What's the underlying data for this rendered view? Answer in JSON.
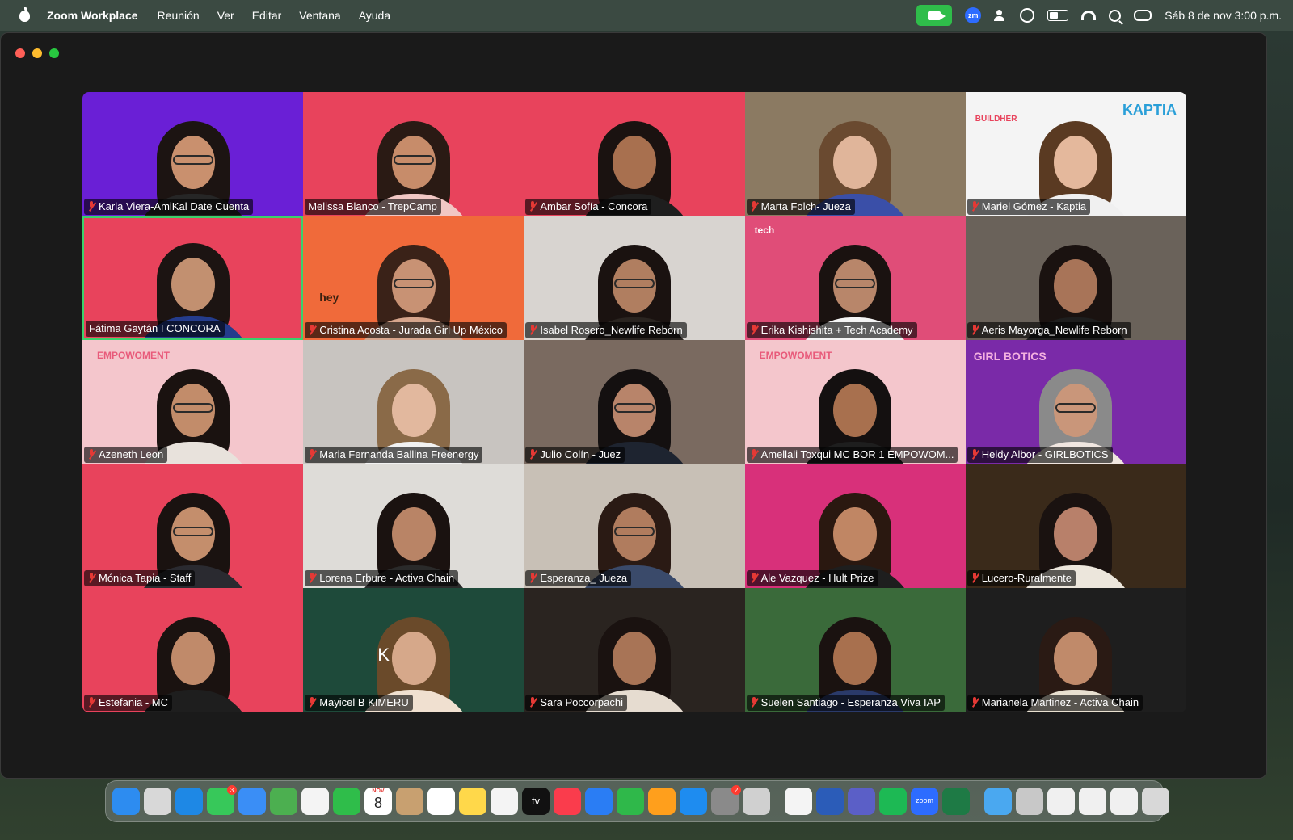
{
  "menubar": {
    "app_name": "Zoom Workplace",
    "menus": [
      "Reunión",
      "Ver",
      "Editar",
      "Ventana",
      "Ayuda"
    ],
    "zoom_badge": "zm",
    "datetime": "Sáb 8 de nov  3:00 p.m."
  },
  "participants": [
    {
      "name": "Karla Viera-AmiKal Date Cuenta",
      "muted": true,
      "bg": "#6a1fd6",
      "hair": "#1c1412",
      "skin": "#c9906e",
      "shirt": "#262626",
      "glasses": true
    },
    {
      "name": "Melissa Blanco - TrepCamp",
      "muted": false,
      "bg": "#e8435c",
      "hair": "#2a1a14",
      "skin": "#c78c6a",
      "shirt": "#f1c7c4",
      "glasses": true
    },
    {
      "name": "Ambar Sofía - Concora",
      "muted": true,
      "bg": "#e8435c",
      "hair": "#1a1210",
      "skin": "#a8704f",
      "shirt": "#1e1e1e",
      "glasses": false
    },
    {
      "name": "Marta Folch- Jueza",
      "muted": true,
      "bg": "#8b7a62",
      "hair": "#6a4a30",
      "skin": "#e0b59a",
      "shirt": "#3a4fa8",
      "glasses": false
    },
    {
      "name": "Mariel Gómez - Kaptia",
      "muted": true,
      "bg": "#f4f4f4",
      "hair": "#5a3a22",
      "skin": "#e4b89c",
      "shirt": "#f0f0f0",
      "glasses": false
    },
    {
      "name": "Fátima Gaytán I CONCORA",
      "muted": false,
      "bg": "#e8435c",
      "hair": "#1c1412",
      "skin": "#c29070",
      "shirt": "#243c8c",
      "glasses": false,
      "active": true
    },
    {
      "name": "Cristina Acosta - Jurada Girl Up México",
      "muted": true,
      "bg": "#f06a3a",
      "hair": "#3a2218",
      "skin": "#c89274",
      "shirt": "#d6a58c",
      "glasses": true
    },
    {
      "name": "Isabel Rosero_Newlife Reborn",
      "muted": true,
      "bg": "#d8d4d0",
      "hair": "#1a1210",
      "skin": "#b07e60",
      "shirt": "#2a2420",
      "glasses": true
    },
    {
      "name": "Erika Kishishita + Tech Academy",
      "muted": true,
      "bg": "#e04d78",
      "hair": "#1a1210",
      "skin": "#b8866a",
      "shirt": "#f4f4f4",
      "glasses": true
    },
    {
      "name": "Aeris Mayorga_Newlife Reborn",
      "muted": true,
      "bg": "#6a625a",
      "hair": "#1a1210",
      "skin": "#a87458",
      "shirt": "#1e1e1e",
      "glasses": false
    },
    {
      "name": "Azeneth Leon",
      "muted": true,
      "bg": "#f4c6cc",
      "hair": "#1a1210",
      "skin": "#c28c6a",
      "shirt": "#e8e2dc",
      "glasses": true
    },
    {
      "name": "Maria Fernanda Ballina Freenergy",
      "muted": true,
      "bg": "#c8c4c0",
      "hair": "#8a6a48",
      "skin": "#e2b89e",
      "shirt": "#f2f2f2",
      "glasses": false
    },
    {
      "name": "Julio Colín - Juez",
      "muted": true,
      "bg": "#7a6a60",
      "hair": "#141010",
      "skin": "#b8846a",
      "shirt": "#1e2430",
      "glasses": true
    },
    {
      "name": "Amellali Toxqui MC BOR 1  EMPOWOM...",
      "muted": true,
      "bg": "#f4c6cc",
      "hair": "#141010",
      "skin": "#a8704e",
      "shirt": "#1e1e1e",
      "glasses": false
    },
    {
      "name": "Heidy Albor - GIRLBOTICS",
      "muted": true,
      "bg": "#7a2aa8",
      "hair": "#8a8a8a",
      "skin": "#c9967a",
      "shirt": "#f0e6e0",
      "glasses": true
    },
    {
      "name": "Mónica Tapia - Staff",
      "muted": true,
      "bg": "#e8435c",
      "hair": "#1a1210",
      "skin": "#c48e6c",
      "shirt": "#2a2a30",
      "glasses": true
    },
    {
      "name": "Lorena Erbure - Activa Chain",
      "muted": true,
      "bg": "#dedcd8",
      "hair": "#1a1210",
      "skin": "#b98466",
      "shirt": "#2a2a2a",
      "glasses": false
    },
    {
      "name": "Esperanza_ Jueza",
      "muted": true,
      "bg": "#c8c0b6",
      "hair": "#2a1a14",
      "skin": "#b07c5e",
      "shirt": "#3a4a6a",
      "glasses": true
    },
    {
      "name": "Ale Vazquez - Hult Prize",
      "muted": true,
      "bg": "#d8307a",
      "hair": "#2a1810",
      "skin": "#c08664",
      "shirt": "#1e1e1e",
      "glasses": false
    },
    {
      "name": "Lucero-Ruralmente",
      "muted": true,
      "bg": "#3a2a1a",
      "hair": "#1a1210",
      "skin": "#b8806a",
      "shirt": "#ece6dc",
      "glasses": false
    },
    {
      "name": "Estefania - MC",
      "muted": true,
      "bg": "#e8435c",
      "hair": "#1a1210",
      "skin": "#c08a6a",
      "shirt": "#1e1e1e",
      "glasses": false
    },
    {
      "name": "Mayicel B KIMERU",
      "muted": true,
      "bg": "#1e4a3a",
      "hair": "#6a4a2a",
      "skin": "#d6a88a",
      "shirt": "#f0e0d0",
      "glasses": false
    },
    {
      "name": "Sara Poccorpachi",
      "muted": true,
      "bg": "#2a2420",
      "hair": "#1a1210",
      "skin": "#a87456",
      "shirt": "#e6dcd0",
      "glasses": false
    },
    {
      "name": "Suelen Santiago - Esperanza Viva IAP",
      "muted": true,
      "bg": "#3a6a3a",
      "hair": "#1a1210",
      "skin": "#a8704e",
      "shirt": "#2a3a6a",
      "glasses": false
    },
    {
      "name": "Marianela Martinez - Activa Chain",
      "muted": true,
      "bg": "#1e1e1e",
      "hair": "#2a1a14",
      "skin": "#c08a6a",
      "shirt": "#e8e0d0",
      "glasses": false
    }
  ],
  "tile_logos": {
    "kaptia": "KAPTIA",
    "builder": "BUILDHER",
    "empowoment": "EMPOWOMENT",
    "girlbotics": "GIRL BOTICS",
    "tech": "tech",
    "kimeru": "K",
    "heyou": "hey"
  },
  "dock": {
    "apps": [
      "finder-icon",
      "launchpad-icon",
      "safari-icon",
      "messages-icon",
      "mail-icon",
      "maps-icon",
      "photos-icon",
      "facetime-icon",
      "calendar-icon",
      "contacts-icon",
      "reminders-icon",
      "notes-icon",
      "freeform-icon",
      "tv-icon",
      "music-icon",
      "keynote-icon",
      "numbers-icon",
      "pages-icon",
      "appstore-icon",
      "settings-icon",
      "iphone-mirroring-icon",
      "chrome-icon",
      "word-icon",
      "teams-icon",
      "spotify-icon",
      "zoom-icon",
      "excel-icon",
      "folder-icon",
      "preview-icon",
      "document-icon",
      "document-icon",
      "document-icon",
      "trash-icon"
    ],
    "colors": [
      "#2d8cf0",
      "#d8d8d8",
      "#1e88e5",
      "#37c85a",
      "#3a8ef6",
      "#4caf50",
      "#f4f4f4",
      "#2fbd4a",
      "#ffffff",
      "#c8a070",
      "#ffffff",
      "#ffd84a",
      "#f4f4f4",
      "#111111",
      "#fa3c4c",
      "#2a7df4",
      "#2fb84a",
      "#ff9f1c",
      "#1e8cf0",
      "#8a8a8a",
      "#d0d0d0",
      "#f4f4f4",
      "#2b5cb8",
      "#5b5fc7",
      "#1db954",
      "#2d6cff",
      "#1e7a45",
      "#4aa8f0",
      "#c8c8c8",
      "#f0f0f0",
      "#f0f0f0",
      "#f0f0f0",
      "#d8d8d8"
    ],
    "calendar_label": "NOV",
    "calendar_day": "8",
    "tv_label": "tv",
    "zoom_label": "zoom",
    "messages_badge": "3",
    "settings_badge": "2"
  }
}
